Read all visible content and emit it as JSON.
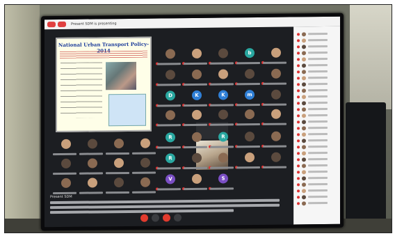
{
  "meeting": {
    "title": "Present SDM is presenting"
  },
  "slide": {
    "title": "National Urban Transport Policy-2014"
  },
  "caption": {
    "speaker": "Present SDM"
  },
  "colors": {
    "record": "#e04040",
    "end_call": "#e23b2e",
    "letter_avatar_blue": "#2f7fd6",
    "letter_avatar_teal": "#29a7a0",
    "letter_avatar_purple": "#7b4fc4"
  },
  "tiles": [
    {
      "letter": ""
    },
    {
      "letter": ""
    },
    {
      "letter": ""
    },
    {
      "letter": "b"
    },
    {
      "letter": ""
    },
    {
      "letter": ""
    },
    {
      "letter": ""
    },
    {
      "letter": ""
    },
    {
      "letter": ""
    },
    {
      "letter": ""
    },
    {
      "letter": "D"
    },
    {
      "letter": "K"
    },
    {
      "letter": "K"
    },
    {
      "letter": "m"
    },
    {
      "letter": ""
    },
    {
      "letter": ""
    },
    {
      "letter": ""
    },
    {
      "letter": ""
    },
    {
      "letter": ""
    },
    {
      "letter": ""
    },
    {
      "letter": "R"
    },
    {
      "letter": ""
    },
    {
      "letter": "R"
    },
    {
      "letter": ""
    },
    {
      "letter": ""
    },
    {
      "letter": "R"
    },
    {
      "letter": ""
    },
    {
      "letter": ""
    },
    {
      "letter": ""
    },
    {
      "letter": ""
    },
    {
      "letter": "V"
    },
    {
      "letter": ""
    },
    {
      "letter": "S"
    }
  ]
}
